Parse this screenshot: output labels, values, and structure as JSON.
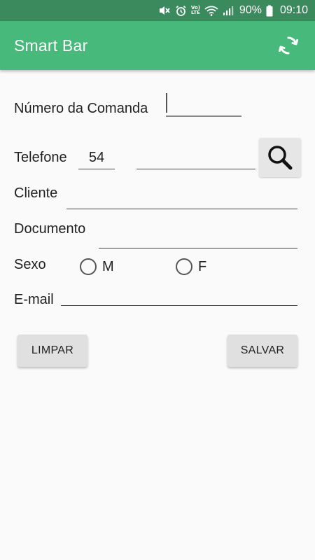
{
  "status_bar": {
    "lte_top": "Vo)",
    "lte_bottom": "LTE",
    "battery": "90%",
    "time": "09:10",
    "icons": [
      "mute-icon",
      "alarm-icon",
      "volte-icon",
      "wifi-icon",
      "signal-icon",
      "battery-icon"
    ]
  },
  "app_bar": {
    "title": "Smart Bar",
    "refresh_icon": "refresh-icon",
    "color": "#47b97a"
  },
  "form": {
    "comanda_label": "Número da Comanda",
    "comanda_value": "",
    "telefone_label": "Telefone",
    "telefone_ddd": "54",
    "telefone_number": "",
    "search_icon": "search-icon",
    "cliente_label": "Cliente",
    "cliente_value": "",
    "documento_label": "Documento",
    "documento_value": "",
    "sexo_label": "Sexo",
    "sexo_options": [
      "M",
      "F"
    ],
    "email_label": "E-mail",
    "email_value": ""
  },
  "actions": {
    "limpar_label": "LIMPAR",
    "salvar_label": "SALVAR"
  }
}
